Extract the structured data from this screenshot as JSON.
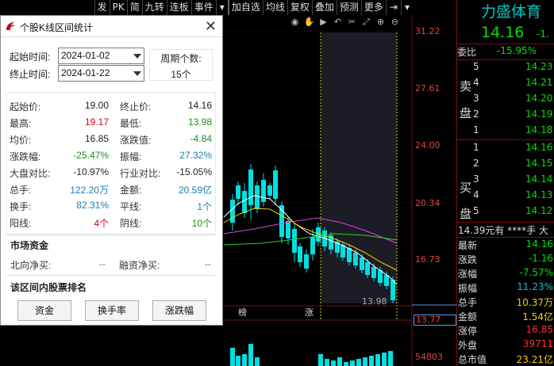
{
  "menu": [
    "发",
    "PK",
    "简",
    "九转",
    "连板",
    "事件",
    "加自选",
    "均线",
    "复权",
    "叠加",
    "预测",
    "更多"
  ],
  "chart": {
    "price_ticks": [
      "31.22",
      "27.61",
      "24.00",
      "20.34",
      "16.73"
    ],
    "current_price_label": "13.77",
    "low_label": "13.98",
    "volume_tick": "54803",
    "bottom_markers": [
      "榜",
      "涨"
    ]
  },
  "dialog": {
    "title": "个股K线区间统计",
    "start_label": "起始时间:",
    "start_value": "2024-01-02",
    "end_label": "终止时间:",
    "end_value": "2024-01-22",
    "cycle_label": "周期个数:",
    "cycle_value": "15个",
    "stats": [
      {
        "l1": "起始价:",
        "v1": "19.00",
        "c1": "#222222",
        "l2": "终止价:",
        "v2": "14.16",
        "c2": "#222222"
      },
      {
        "l1": "最高:",
        "v1": "19.17",
        "c1": "#d0021b",
        "l2": "最低:",
        "v2": "13.98",
        "c2": "#1a8f1a"
      },
      {
        "l1": "均价:",
        "v1": "16.85",
        "c1": "#222222",
        "l2": "涨跌值:",
        "v2": "-4.84",
        "c2": "#1a8f1a"
      },
      {
        "l1": "涨跌幅:",
        "v1": "-25.47%",
        "c1": "#1a8f1a",
        "l2": "振幅:",
        "v2": "27.32%",
        "c2": "#1a7fb0"
      },
      {
        "l1": "大盘对比:",
        "v1": "-10.97%",
        "c1": "#222222",
        "l2": "行业对比:",
        "v2": "-15.05%",
        "c2": "#222222"
      },
      {
        "l1": "总手:",
        "v1": "122.20万",
        "c1": "#1a7fb0",
        "l2": "金额:",
        "v2": "20.59亿",
        "c2": "#1a7fb0"
      },
      {
        "l1": "换手:",
        "v1": "82.31%",
        "c1": "#1a7fb0",
        "l2": "平线:",
        "v2": "1个",
        "c2": "#1a7fb0"
      },
      {
        "l1": "阳线:",
        "v1": "4个",
        "c1": "#d0021b",
        "l2": "阴线:",
        "v2": "10个",
        "c2": "#1a8f1a"
      }
    ],
    "market_fund_title": "市场资金",
    "northbound_label": "北向净买:",
    "northbound_value": "--",
    "margin_label": "融资净买:",
    "margin_value": "--",
    "rank_title": "该区间内股票排名",
    "buttons": [
      "资金",
      "换手率",
      "涨跌幅"
    ]
  },
  "quote": {
    "name": "力盛体育",
    "price": "14.16",
    "change": "-1.",
    "weibi_label": "委比",
    "weibi_value": "-15.95%",
    "sell_side": "卖盘",
    "buy_side": "买盘",
    "asks": [
      {
        "idx": "5",
        "price": "14.23"
      },
      {
        "idx": "4",
        "price": "14.21"
      },
      {
        "idx": "3",
        "price": "14.20"
      },
      {
        "idx": "2",
        "price": "14.19"
      },
      {
        "idx": "1",
        "price": "14.18"
      }
    ],
    "bids": [
      {
        "idx": "1",
        "price": "14.16"
      },
      {
        "idx": "2",
        "price": "14.15"
      },
      {
        "idx": "3",
        "price": "14.14"
      },
      {
        "idx": "4",
        "price": "14.13"
      },
      {
        "idx": "5",
        "price": "14.12"
      }
    ],
    "latest_line": "14.39元有 ****手 大",
    "fields": [
      {
        "label": "最新",
        "value": "14.16",
        "color": "#00e000"
      },
      {
        "label": "涨跌",
        "value": "-1.16",
        "color": "#00e000"
      },
      {
        "label": "涨幅",
        "value": "-7.57%",
        "color": "#00e000"
      },
      {
        "label": "振幅",
        "value": "11.23%",
        "color": "#00c8c8"
      },
      {
        "label": "总手",
        "value": "10.37万",
        "color": "#f0d000"
      },
      {
        "label": "金额",
        "value": "1.54亿",
        "color": "#f0d000"
      },
      {
        "label": "涨停",
        "value": "16.85",
        "color": "#ff3030"
      },
      {
        "label": "外盘",
        "value": "39711",
        "color": "#ff3030"
      },
      {
        "label": "总市值",
        "value": "23.21亿",
        "color": "#f0d000"
      }
    ]
  }
}
